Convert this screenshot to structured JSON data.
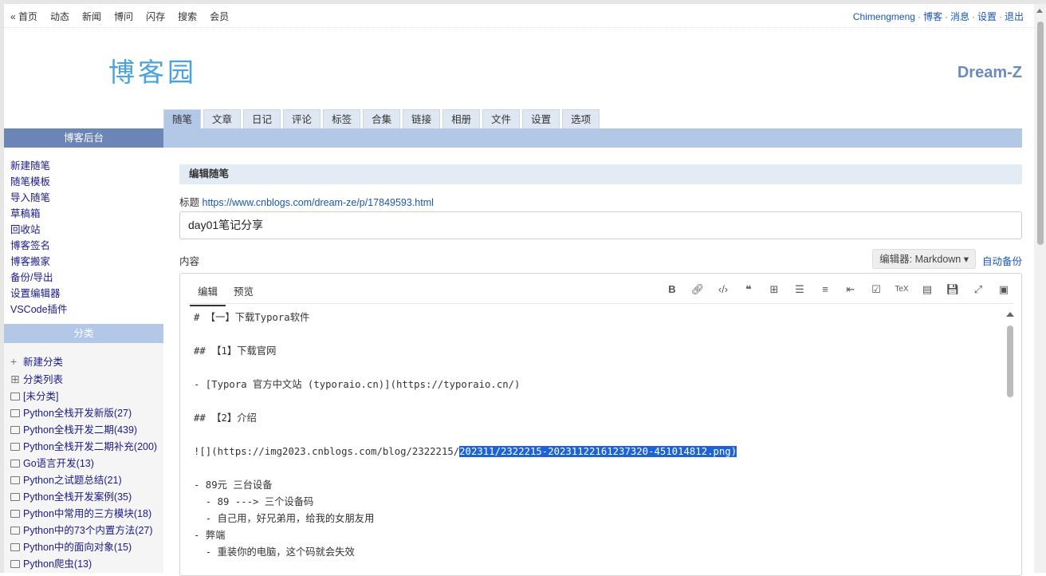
{
  "topnav": [
    "« 首页",
    "动态",
    "新闻",
    "博问",
    "闪存",
    "搜索",
    "会员"
  ],
  "user": {
    "name": "Chimengmeng",
    "links": [
      "博客",
      "消息",
      "设置",
      "退出"
    ]
  },
  "logo_text": "博客园",
  "blog_name": "Dream-Z",
  "tabs": [
    "随笔",
    "文章",
    "日记",
    "评论",
    "标签",
    "合集",
    "链接",
    "相册",
    "文件",
    "设置",
    "选项"
  ],
  "sidebar": {
    "header": "博客后台",
    "links": [
      "新建随笔",
      "随笔模板",
      "导入随笔",
      "草稿箱",
      "回收站",
      "博客签名",
      "博客搬家",
      "备份/导出",
      "设置编辑器",
      "VSCode插件"
    ],
    "category_header": "分类",
    "category_actions": [
      "新建分类",
      "分类列表"
    ],
    "categories": [
      "[未分类]",
      "Python全栈开发新版(27)",
      "Python全栈开发二期(439)",
      "Python全栈开发二期补充(200)",
      "Go语言开发(13)",
      "Python之试题总结(21)",
      "Python全栈开发案例(35)",
      "Python中常用的三方模块(18)",
      "Python中的73个内置方法(27)",
      "Python中的面向对象(15)",
      "Python爬虫(13)"
    ]
  },
  "main": {
    "header": "编辑随笔",
    "title_label": "标题",
    "title_url": "https://www.cnblogs.com/dream-ze/p/17849593.html",
    "title_value": "day01笔记分享",
    "content_label": "内容",
    "editor_select": "编辑器: Markdown ▾",
    "autosave": "自动备份",
    "editor_tabs": [
      "编辑",
      "预览"
    ],
    "toolbar_icons": [
      "bold-icon",
      "link-icon",
      "code-icon",
      "quote-icon",
      "table-icon",
      "list-icon",
      "ordered-list-icon",
      "indent-icon",
      "checkbox-icon",
      "tex-icon",
      "toc-icon",
      "save-icon",
      "fullscreen-icon",
      "image-icon"
    ],
    "code_lines": [
      "# 【一】下载Typora软件",
      "",
      "## 【1】下载官网",
      "",
      "- [Typora 官方中文站 (typoraio.cn)](https://typoraio.cn/)",
      "",
      "## 【2】介绍",
      "",
      "",
      "",
      "- 89元 三台设备",
      "  - 89 ---> 三个设备码",
      "  - 自己用，好兄弟用，给我的女朋友用",
      "- 弊端",
      "  - 重装你的电脑，这个码就会失效"
    ],
    "image_line_prefix": "![](https://img2023.cnblogs.com/blog/2322215/",
    "image_line_selected": "202311/2322215-20231122161237320-451014812.png)"
  }
}
